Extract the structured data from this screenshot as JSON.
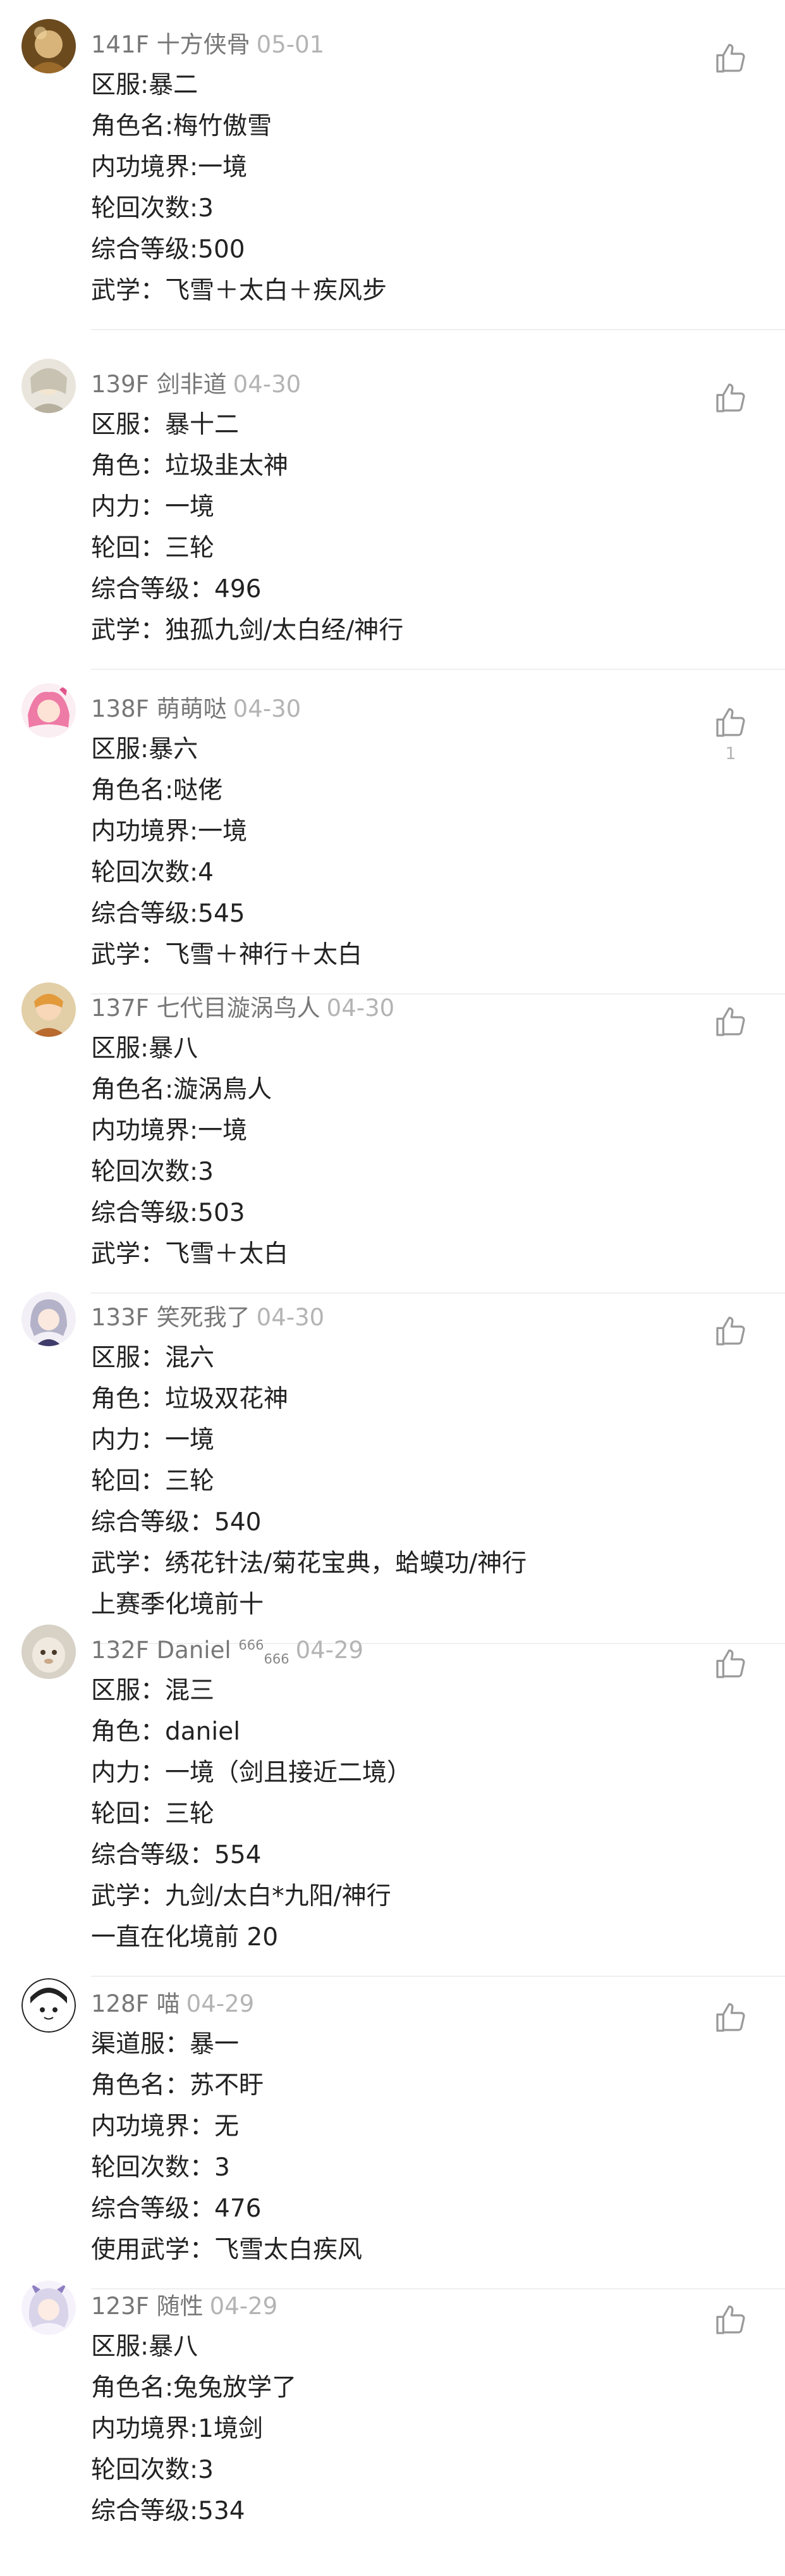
{
  "comments": [
    {
      "floor": "141F",
      "user": "十方侠骨",
      "date": "05-01",
      "likes": "",
      "lines": [
        "区服:暴二",
        "角色名:梅竹傲雪",
        "内功境界:一境",
        "轮回次数:3",
        "综合等级:500",
        "武学：飞雪＋太白＋疾风步"
      ]
    },
    {
      "floor": "139F",
      "user": "剑非道",
      "date": "04-30",
      "likes": "",
      "lines": [
        "区服：暴十二",
        "角色：垃圾韭太神",
        "内力：一境",
        "轮回：三轮",
        "综合等级：496",
        "武学：独孤九剑/太白经/神行"
      ]
    },
    {
      "floor": "138F",
      "user": "萌萌哒",
      "date": "04-30",
      "likes": "1",
      "lines": [
        "区服:暴六",
        "角色名:哒佬",
        "内功境界:一境",
        "轮回次数:4",
        "综合等级:545",
        "武学：飞雪＋神行＋太白"
      ]
    },
    {
      "floor": "137F",
      "user": "七代目漩涡鸟人",
      "date": "04-30",
      "likes": "",
      "lines": [
        "区服:暴八",
        "角色名:漩涡鳥人",
        "内功境界:一境",
        "轮回次数:3",
        "综合等级:503",
        "武学：飞雪＋太白"
      ]
    },
    {
      "floor": "133F",
      "user": "笑死我了",
      "date": "04-30",
      "likes": "",
      "lines": [
        "区服：混六",
        "角色：垃圾双花神",
        "内力：一境",
        "轮回：三轮",
        "综合等级：540",
        "武学：绣花针法/菊花宝典，蛤蟆功/神行",
        "上赛季化境前十"
      ]
    },
    {
      "floor": "132F",
      "user": "Daniel",
      "badge_sup": "666",
      "badge_sub": "666",
      "date": "04-29",
      "likes": "",
      "lines": [
        "区服：混三",
        "角色：daniel",
        "内力：一境（剑且接近二境）",
        "轮回：三轮",
        "综合等级：554",
        "武学：九剑/太白*九阳/神行",
        "一直在化境前 20"
      ]
    },
    {
      "floor": "128F",
      "user": "喵",
      "date": "04-29",
      "likes": "",
      "lines": [
        "渠道服：暴一",
        "角色名：苏不盱",
        "内功境界：无",
        "轮回次数：3",
        "综合等级：476",
        "使用武学：飞雪太白疾风"
      ]
    },
    {
      "floor": "123F",
      "user": "随性",
      "date": "04-29",
      "likes": "",
      "lines": [
        "区服:暴八",
        "角色名:兔兔放学了",
        "内功境界:1境剑",
        "轮回次数:3",
        "综合等级:534"
      ]
    }
  ],
  "icons": {
    "like": "thumbs-up-icon"
  },
  "colors": {
    "meta": "#777777",
    "date": "#b4b4b4",
    "text": "#222222",
    "divider": "#efefef"
  }
}
